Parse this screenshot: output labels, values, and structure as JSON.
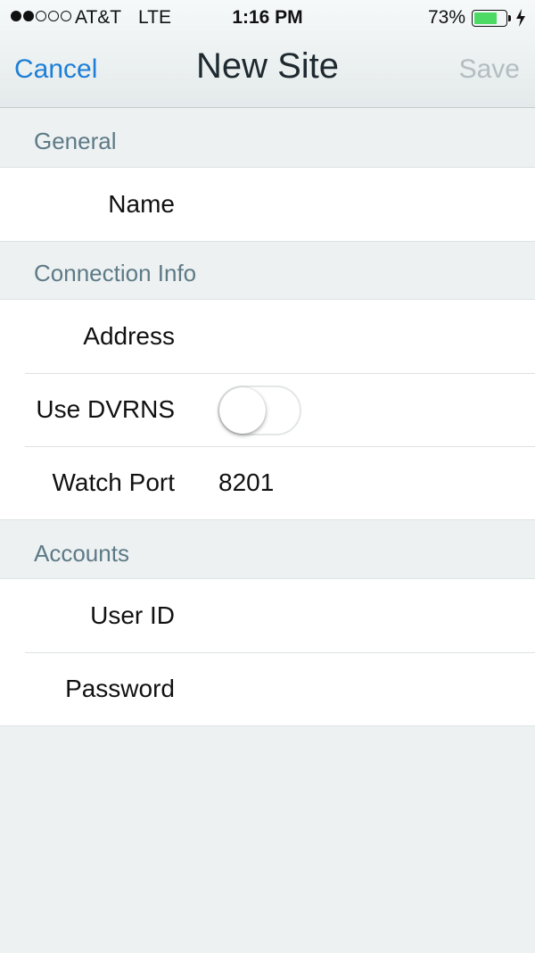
{
  "status_bar": {
    "carrier": "AT&T",
    "network": "LTE",
    "time": "1:16 PM",
    "battery_percent_label": "73%",
    "battery_level": 0.73,
    "signal_bars_filled": 2,
    "signal_bars_total": 5,
    "battery_color": "#4cd964"
  },
  "nav": {
    "cancel_label": "Cancel",
    "title": "New Site",
    "save_label": "Save",
    "accent_color": "#1d7fd6"
  },
  "sections": {
    "general": {
      "header": "General",
      "name_label": "Name",
      "name_value": ""
    },
    "connection": {
      "header": "Connection Info",
      "address_label": "Address",
      "address_value": "",
      "dvrns_label": "Use DVRNS",
      "dvrns_on": false,
      "watch_port_label": "Watch Port",
      "watch_port_value": "8201"
    },
    "accounts": {
      "header": "Accounts",
      "user_id_label": "User ID",
      "user_id_value": "",
      "password_label": "Password",
      "password_value": ""
    }
  }
}
